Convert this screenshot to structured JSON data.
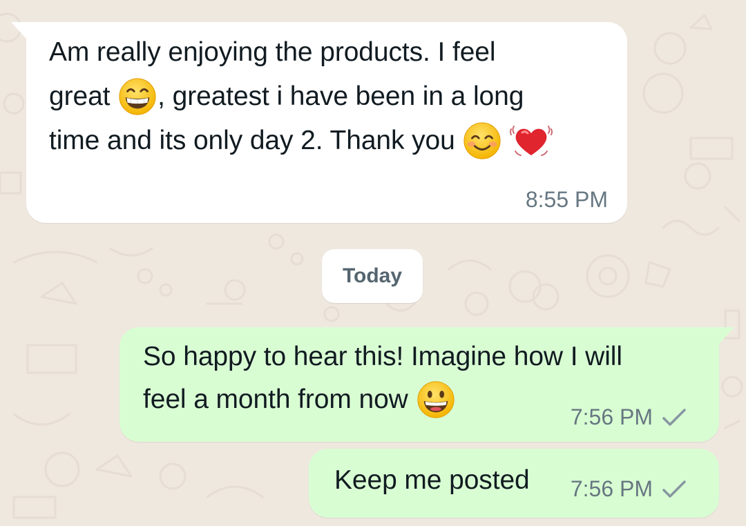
{
  "conversation": {
    "incoming_message": {
      "line1": "Am really enjoying the products.   I feel",
      "line2_start": "great",
      "line2_end": ", greatest i have been in a long",
      "line3": "time and its only day 2. Thank you",
      "emojis": [
        "grinning-eyes-emoji",
        "smiling-face-emoji",
        "beating-heart-emoji"
      ],
      "time": "8:55 PM"
    },
    "date_divider": "Today",
    "outgoing_messages": [
      {
        "line1": "So happy to hear this! Imagine how I will",
        "line2": "feel a month from now",
        "emoji": "grinning-face-emoji",
        "time": "7:56 PM",
        "status_icon": "single-check-icon"
      },
      {
        "text": "Keep me posted",
        "time": "7:56 PM",
        "status_icon": "single-check-icon"
      }
    ]
  },
  "colors": {
    "chat_background": "#efe8df",
    "incoming_bubble": "#ffffff",
    "outgoing_bubble": "#d9fdd3",
    "timestamp": "#667781",
    "check": "#8696a0"
  }
}
